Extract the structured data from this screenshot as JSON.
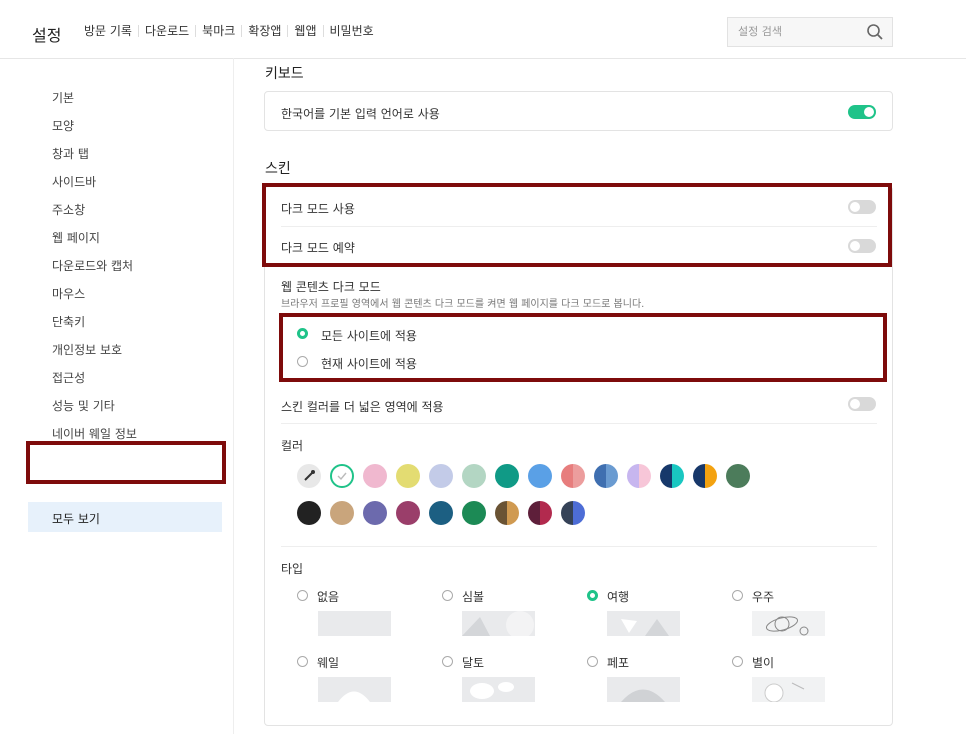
{
  "header": {
    "title": "설정",
    "nav": [
      "방문 기록",
      "다운로드",
      "북마크",
      "확장앱",
      "웹앱",
      "비밀번호"
    ],
    "search_placeholder": "설정 검색"
  },
  "sidebar": {
    "items": [
      "기본",
      "모양",
      "창과 탭",
      "사이드바",
      "주소창",
      "웹 페이지",
      "다운로드와 캡처",
      "마우스",
      "단축키",
      "개인정보 보호",
      "접근성",
      "성능 및 기타",
      "네이버 웨일 정보"
    ],
    "active": "모두 보기"
  },
  "keyboard": {
    "title": "키보드",
    "option": "한국어를 기본 입력 언어로 사용",
    "option_on": true
  },
  "skin": {
    "title": "스킨",
    "dark_mode": "다크 모드 사용",
    "dark_schedule": "다크 모드 예약",
    "web_dark_title": "웹 콘텐츠 다크 모드",
    "web_dark_desc": "브라우저 프로필 영역에서 웹 콘텐츠 다크 모드를 켜면 웹 페이지를 다크 모드로 봅니다.",
    "radio_all": "모든 사이트에 적용",
    "radio_current": "현재 사이트에 적용",
    "wide_color": "스킨 컬러를 더 넓은 영역에 적용",
    "color_label": "컬러",
    "type_label": "타입",
    "types": [
      "없음",
      "심볼",
      "여행",
      "우주",
      "웨일",
      "달토",
      "페포",
      "별이"
    ],
    "selected_type": "여행"
  },
  "colors": {
    "accent": "#1fc389",
    "highlight_box": "#7e0b0b",
    "row1": [
      "eyedropper",
      "#ffffff",
      "#f0b8cf",
      "#e3dc72",
      "#c3cbe8",
      "#b3d6c3",
      "#109a86",
      "#5aa0e6",
      "split:#e77d7d/#ec9d9d",
      "split:#3f6fb0/#6a9bd1",
      "split:#c7b6ef/#f7c6d8",
      "split:#17386a/#19c7c1",
      "split:#17386a/#f3a210",
      "#4c7c5b"
    ],
    "row2": [
      "#222222",
      "#c9a57c",
      "#6c6aad",
      "#9a3e6a",
      "#1c5f82",
      "#1c8a55",
      "split:#6a5334/#d09a51",
      "split:#5e1f3a/#b22a4e",
      "split:#354257/#4d6dd6"
    ]
  }
}
